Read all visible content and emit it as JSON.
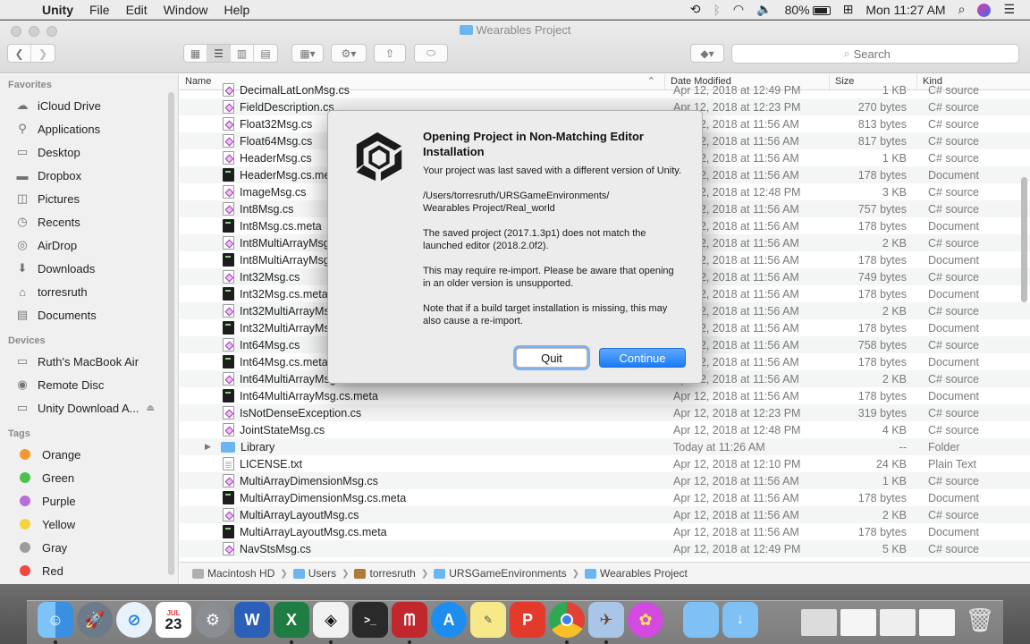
{
  "menubar": {
    "app_name": "Unity",
    "menus": [
      "File",
      "Edit",
      "Window",
      "Help"
    ],
    "battery": "80%",
    "clock": "Mon 11:27 AM"
  },
  "window": {
    "title": "Wearables Project",
    "search_placeholder": "Search"
  },
  "sidebar": {
    "favorites_header": "Favorites",
    "favorites": [
      {
        "label": "iCloud Drive",
        "icon": "cloud-icon"
      },
      {
        "label": "Applications",
        "icon": "applications-icon"
      },
      {
        "label": "Desktop",
        "icon": "desktop-icon"
      },
      {
        "label": "Dropbox",
        "icon": "folder-icon"
      },
      {
        "label": "Pictures",
        "icon": "camera-icon"
      },
      {
        "label": "Recents",
        "icon": "clock-icon"
      },
      {
        "label": "AirDrop",
        "icon": "airdrop-icon"
      },
      {
        "label": "Downloads",
        "icon": "download-icon"
      },
      {
        "label": "torresruth",
        "icon": "home-icon"
      },
      {
        "label": "Documents",
        "icon": "document-icon"
      }
    ],
    "devices_header": "Devices",
    "devices": [
      {
        "label": "Ruth's MacBook Air",
        "icon": "laptop-icon"
      },
      {
        "label": "Remote Disc",
        "icon": "disc-icon"
      },
      {
        "label": "Unity Download A...",
        "icon": "drive-icon"
      }
    ],
    "tags_header": "Tags",
    "tags": [
      {
        "label": "Orange",
        "color": "#f39a2e"
      },
      {
        "label": "Green",
        "color": "#4ac34a"
      },
      {
        "label": "Purple",
        "color": "#b66ed9"
      },
      {
        "label": "Yellow",
        "color": "#f4d43a"
      },
      {
        "label": "Gray",
        "color": "#9c9c9c"
      },
      {
        "label": "Red",
        "color": "#f0483f"
      }
    ]
  },
  "columns": {
    "name": "Name",
    "date": "Date Modified",
    "size": "Size",
    "kind": "Kind"
  },
  "files": [
    {
      "name": "DecimalLatLonMsg.cs",
      "date": "Apr 12, 2018 at 12:49 PM",
      "size": "1 KB",
      "kind": "C# source",
      "type": "cs"
    },
    {
      "name": "FieldDescription.cs",
      "date": "Apr 12, 2018 at 12:23 PM",
      "size": "270 bytes",
      "kind": "C# source",
      "type": "cs"
    },
    {
      "name": "Float32Msg.cs",
      "date": "Apr 12, 2018 at 11:56 AM",
      "size": "813 bytes",
      "kind": "C# source",
      "type": "cs"
    },
    {
      "name": "Float64Msg.cs",
      "date": "Apr 12, 2018 at 11:56 AM",
      "size": "817 bytes",
      "kind": "C# source",
      "type": "cs"
    },
    {
      "name": "HeaderMsg.cs",
      "date": "Apr 12, 2018 at 11:56 AM",
      "size": "1 KB",
      "kind": "C# source",
      "type": "cs"
    },
    {
      "name": "HeaderMsg.cs.meta",
      "date": "Apr 12, 2018 at 11:56 AM",
      "size": "178 bytes",
      "kind": "Document",
      "type": "meta"
    },
    {
      "name": "ImageMsg.cs",
      "date": "Apr 12, 2018 at 12:48 PM",
      "size": "3 KB",
      "kind": "C# source",
      "type": "cs"
    },
    {
      "name": "Int8Msg.cs",
      "date": "Apr 12, 2018 at 11:56 AM",
      "size": "757 bytes",
      "kind": "C# source",
      "type": "cs"
    },
    {
      "name": "Int8Msg.cs.meta",
      "date": "Apr 12, 2018 at 11:56 AM",
      "size": "178 bytes",
      "kind": "Document",
      "type": "meta"
    },
    {
      "name": "Int8MultiArrayMsg.cs",
      "date": "Apr 12, 2018 at 11:56 AM",
      "size": "2 KB",
      "kind": "C# source",
      "type": "cs"
    },
    {
      "name": "Int8MultiArrayMsg.cs.meta",
      "date": "Apr 12, 2018 at 11:56 AM",
      "size": "178 bytes",
      "kind": "Document",
      "type": "meta"
    },
    {
      "name": "Int32Msg.cs",
      "date": "Apr 12, 2018 at 11:56 AM",
      "size": "749 bytes",
      "kind": "C# source",
      "type": "cs"
    },
    {
      "name": "Int32Msg.cs.meta",
      "date": "Apr 12, 2018 at 11:56 AM",
      "size": "178 bytes",
      "kind": "Document",
      "type": "meta"
    },
    {
      "name": "Int32MultiArrayMsg.cs",
      "date": "Apr 12, 2018 at 11:56 AM",
      "size": "2 KB",
      "kind": "C# source",
      "type": "cs"
    },
    {
      "name": "Int32MultiArrayMsg.cs.meta",
      "date": "Apr 12, 2018 at 11:56 AM",
      "size": "178 bytes",
      "kind": "Document",
      "type": "meta"
    },
    {
      "name": "Int64Msg.cs",
      "date": "Apr 12, 2018 at 11:56 AM",
      "size": "758 bytes",
      "kind": "C# source",
      "type": "cs"
    },
    {
      "name": "Int64Msg.cs.meta",
      "date": "Apr 12, 2018 at 11:56 AM",
      "size": "178 bytes",
      "kind": "Document",
      "type": "meta"
    },
    {
      "name": "Int64MultiArrayMsg.cs",
      "date": "Apr 12, 2018 at 11:56 AM",
      "size": "2 KB",
      "kind": "C# source",
      "type": "cs"
    },
    {
      "name": "Int64MultiArrayMsg.cs.meta",
      "date": "Apr 12, 2018 at 11:56 AM",
      "size": "178 bytes",
      "kind": "Document",
      "type": "meta"
    },
    {
      "name": "IsNotDenseException.cs",
      "date": "Apr 12, 2018 at 12:23 PM",
      "size": "319 bytes",
      "kind": "C# source",
      "type": "cs"
    },
    {
      "name": "JointStateMsg.cs",
      "date": "Apr 12, 2018 at 12:48 PM",
      "size": "4 KB",
      "kind": "C# source",
      "type": "cs"
    },
    {
      "name": "Library",
      "date": "Today at 11:26 AM",
      "size": "--",
      "kind": "Folder",
      "type": "folder"
    },
    {
      "name": "LICENSE.txt",
      "date": "Apr 12, 2018 at 12:10 PM",
      "size": "24 KB",
      "kind": "Plain Text",
      "type": "txt"
    },
    {
      "name": "MultiArrayDimensionMsg.cs",
      "date": "Apr 12, 2018 at 11:56 AM",
      "size": "1 KB",
      "kind": "C# source",
      "type": "cs"
    },
    {
      "name": "MultiArrayDimensionMsg.cs.meta",
      "date": "Apr 12, 2018 at 11:56 AM",
      "size": "178 bytes",
      "kind": "Document",
      "type": "meta"
    },
    {
      "name": "MultiArrayLayoutMsg.cs",
      "date": "Apr 12, 2018 at 11:56 AM",
      "size": "2 KB",
      "kind": "C# source",
      "type": "cs"
    },
    {
      "name": "MultiArrayLayoutMsg.cs.meta",
      "date": "Apr 12, 2018 at 11:56 AM",
      "size": "178 bytes",
      "kind": "Document",
      "type": "meta"
    },
    {
      "name": "NavStsMsg.cs",
      "date": "Apr 12, 2018 at 12:49 PM",
      "size": "5 KB",
      "kind": "C# source",
      "type": "cs"
    }
  ],
  "pathbar": [
    "Macintosh HD",
    "Users",
    "torresruth",
    "URSGameEnvironments",
    "Wearables Project"
  ],
  "dialog": {
    "title": "Opening Project in Non-Matching Editor Installation",
    "p1": "Your project was last saved with a different version of Unity.",
    "p2": "  /Users/torresruth/URSGameEnvironments/\nWearables Project/Real_world",
    "p3": "The saved project (2017.1.3p1) does not match the launched editor (2018.2.0f2).",
    "p4": "This may require re-import. Please be aware that opening in an older version is unsupported.",
    "p5": "Note that if a build target installation is missing, this may also cause a re-import.",
    "quit_label": "Quit",
    "continue_label": "Continue"
  },
  "dock": {
    "calendar_month": "JUL",
    "calendar_day": "23",
    "apps": [
      "Finder",
      "Launchpad",
      "Safari",
      "Calendar",
      "System Preferences",
      "Word",
      "Excel",
      "Unity",
      "Terminal",
      "Mendeley",
      "App Store",
      "Stickies",
      "Acrobat",
      "Chrome",
      "Preview",
      "Flower"
    ]
  }
}
